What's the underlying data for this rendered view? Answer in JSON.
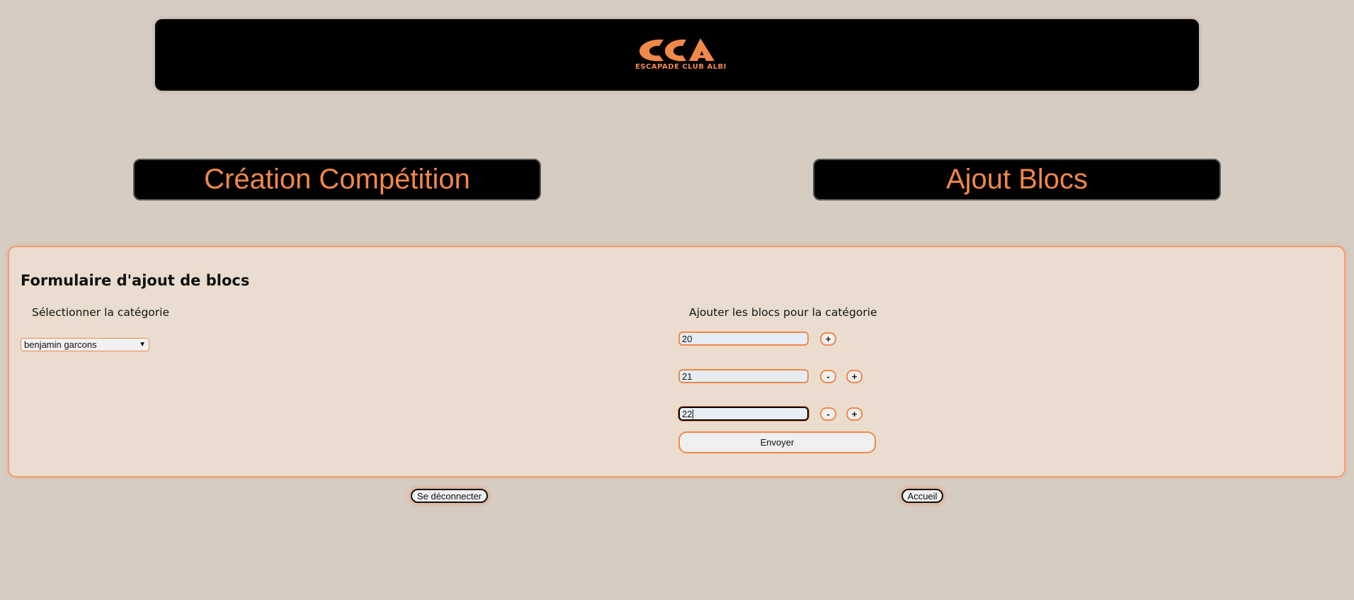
{
  "header": {
    "logo_text": "ESCAPADE CLUB ALBI",
    "logo_icon": "eca-logo-icon"
  },
  "nav": {
    "left_label": "Création Compétition",
    "right_label": "Ajout Blocs"
  },
  "form": {
    "title": "Formulaire d'ajout de blocs",
    "category_label": "Sélectionner la catégorie",
    "category_selected": "benjamin garcons",
    "blocs_label": "Ajouter les blocs pour la catégorie",
    "blocs": [
      {
        "value": "20",
        "minus": null,
        "plus": "+"
      },
      {
        "value": "21",
        "minus": "-",
        "plus": "+"
      },
      {
        "value": "22",
        "minus": "-",
        "plus": "+"
      }
    ],
    "submit_label": "Envoyer"
  },
  "footer": {
    "logout_label": "Se déconnecter",
    "home_label": "Accueil"
  },
  "colors": {
    "background": "#d6ccc2",
    "accent": "#f0884a",
    "panel": "#eaddcf",
    "header": "#000000"
  }
}
